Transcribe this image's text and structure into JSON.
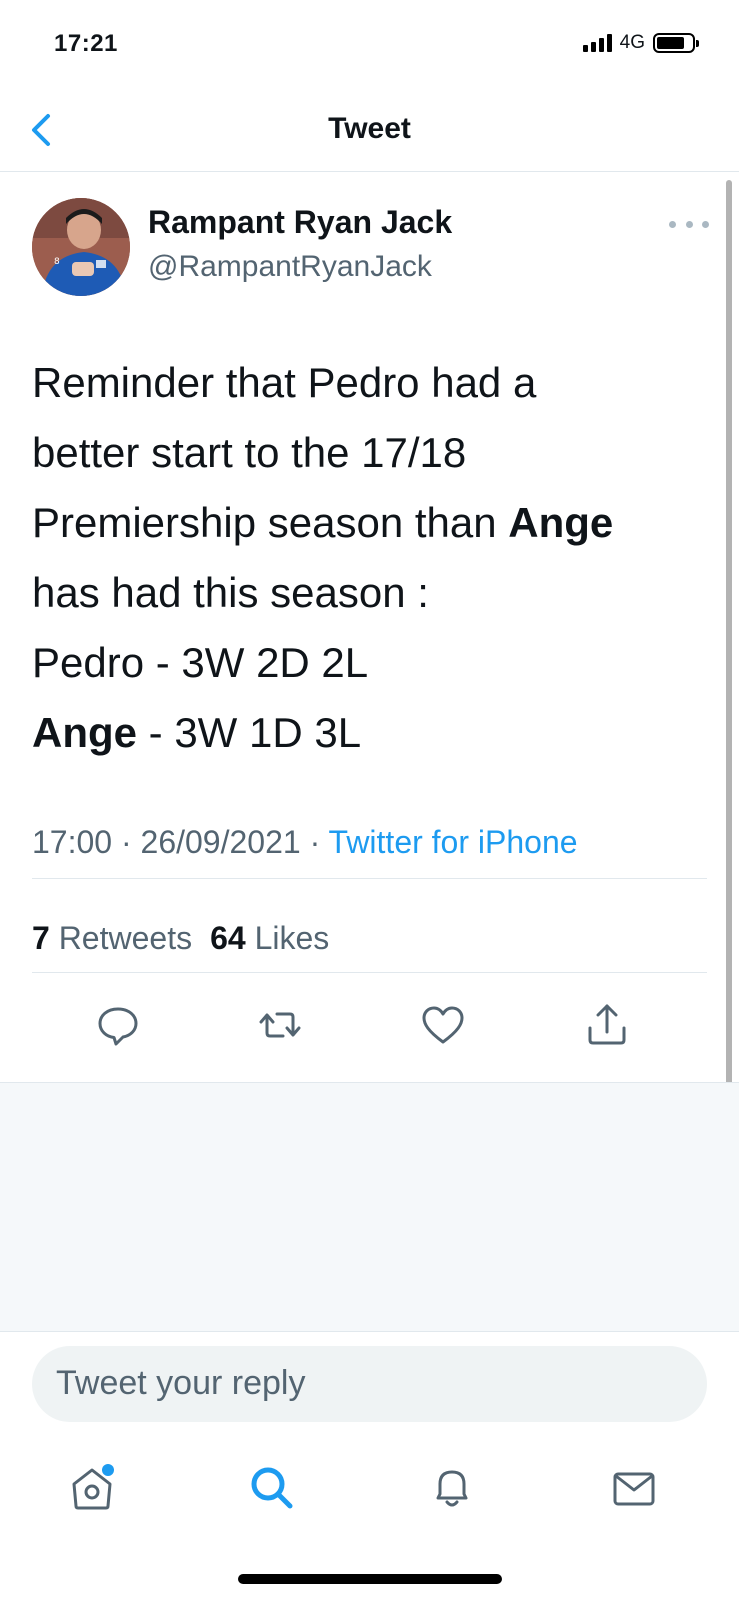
{
  "status_bar": {
    "time": "17:21",
    "network": "4G"
  },
  "header": {
    "title": "Tweet",
    "back_icon": "chevron-left-icon"
  },
  "tweet": {
    "author_name": "Rampant Ryan Jack",
    "author_handle": "@RampantRyanJack",
    "text_lines": [
      [
        "Reminder that Pedro had a"
      ],
      [
        "better start to the 17/18"
      ],
      [
        "Premiership season than ",
        "Ange"
      ],
      [
        "has had this season :"
      ],
      [
        "Pedro - 3W 2D 2L"
      ],
      [
        "Ange",
        " - 3W 1D 3L"
      ]
    ],
    "time": "17:00",
    "date": "26/09/2021",
    "source": "Twitter for iPhone",
    "retweets_count": "7",
    "retweets_label": "Retweets",
    "likes_count": "64",
    "likes_label": "Likes"
  },
  "actions": [
    "reply-icon",
    "retweet-icon",
    "like-icon",
    "share-icon"
  ],
  "reply": {
    "placeholder": "Tweet your reply"
  },
  "tab_bar": [
    "home-icon",
    "search-icon",
    "notifications-icon",
    "messages-icon"
  ],
  "colors": {
    "accent": "#1d9bf0",
    "text_primary": "#0f1419",
    "text_secondary": "#536471",
    "divider": "#e1e8ed"
  }
}
